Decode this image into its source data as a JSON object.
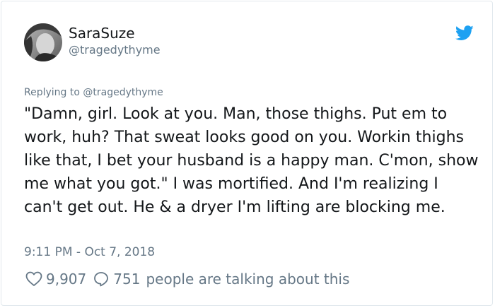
{
  "author": {
    "display_name": "SaraSuze",
    "handle": "@tragedythyme"
  },
  "reply_context": "Replying to @tragedythyme",
  "tweet_text": "\"Damn, girl. Look at you. Man, those thighs. Put em to work, huh? That sweat looks good on you. Workin thighs like that, I bet your husband is a happy man. C'mon, show me what you got.\" I was mortified. And I'm realizing I can't get out. He & a dryer I'm lifting are blocking me.",
  "timestamp": "9:11 PM - Oct 7, 2018",
  "stats": {
    "likes": "9,907",
    "talking_count": "751",
    "talking_label": "people are talking about this"
  },
  "icons": {
    "brand": "twitter-bird-icon",
    "like": "heart-icon",
    "reply": "speech-bubble-icon"
  },
  "colors": {
    "brand_blue": "#1da1f2",
    "secondary_text": "#657786",
    "primary_text": "#14171a",
    "border": "#e1e8ed"
  }
}
